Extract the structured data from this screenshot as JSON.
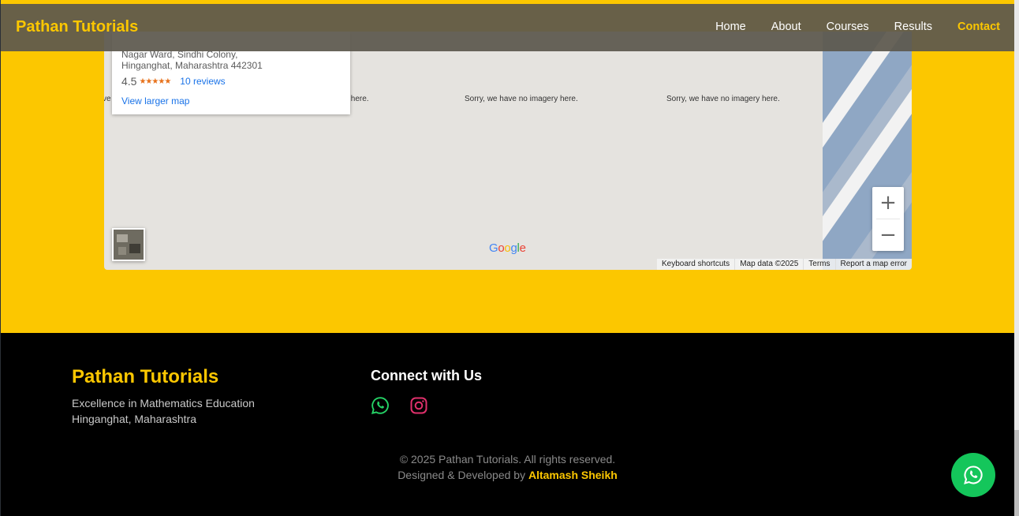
{
  "navbar": {
    "brand": "Pathan Tutorials",
    "links": [
      "Home",
      "About",
      "Courses",
      "Results",
      "Contact"
    ],
    "active": "Contact"
  },
  "map": {
    "info": {
      "address_line1": "Nagar Ward, Sindhi Colony,",
      "address_line2": "Hinganghat, Maharashtra 442301",
      "rating": "4.5",
      "stars": "★★★★★",
      "reviews": "10 reviews",
      "larger_map": "View larger map"
    },
    "no_imagery_partial_left": "ve",
    "no_imagery_partial_mid": "y here.",
    "no_imagery": "Sorry, we have no imagery here.",
    "zoom_in": "+",
    "zoom_out": "−",
    "google_logo": "Google",
    "footer": {
      "keyboard": "Keyboard shortcuts",
      "map_data": "Map data ©2025",
      "terms": "Terms",
      "report": "Report a map error"
    }
  },
  "footer": {
    "brand": "Pathan Tutorials",
    "tagline": "Excellence in Mathematics Education",
    "location": "Hinganghat, Maharashtra",
    "connect_title": "Connect with Us",
    "copyright": "© 2025 Pathan Tutorials. All rights reserved.",
    "designed_prefix": "Designed & Developed by",
    "author": "Altamash Sheikh"
  },
  "colors": {
    "accent": "#fcc700",
    "whatsapp": "#14c65b",
    "instagram": "#e1306c"
  }
}
